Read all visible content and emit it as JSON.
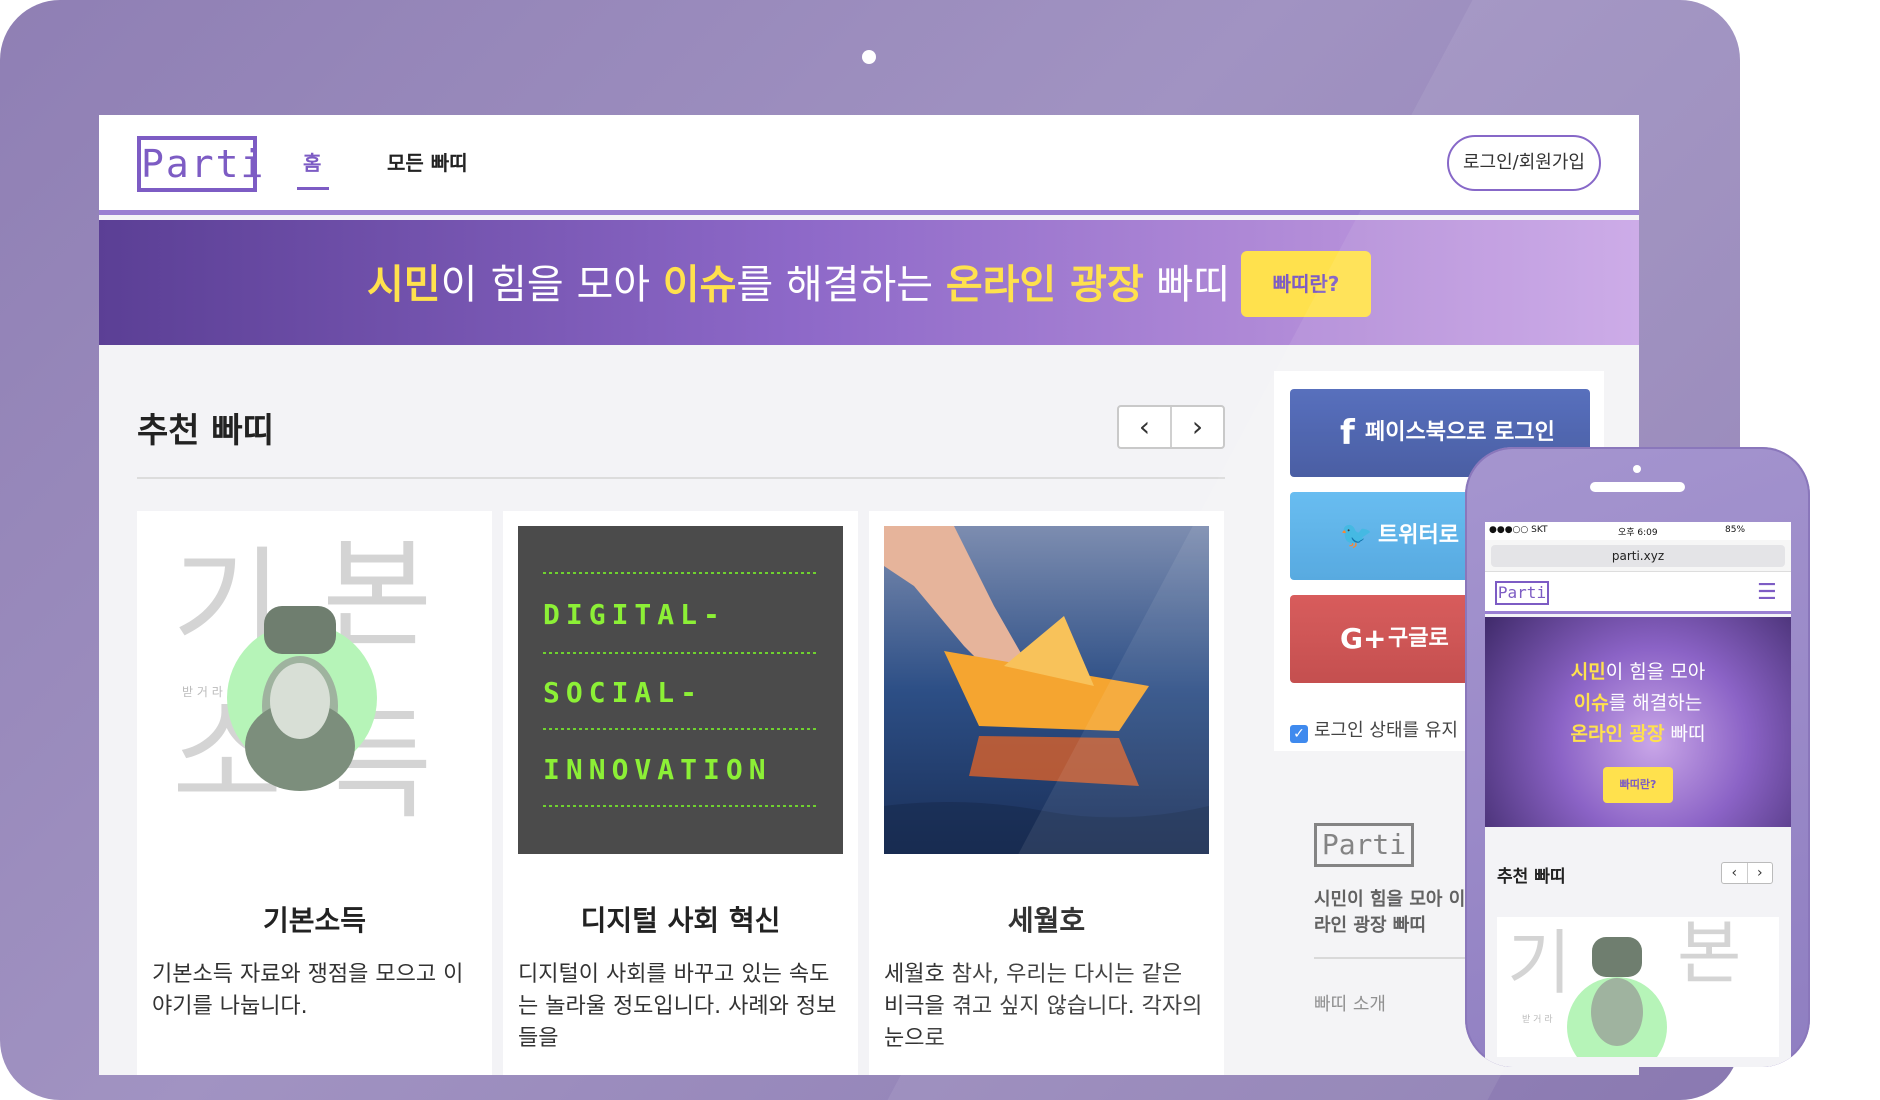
{
  "nav": {
    "logo": "Parti",
    "home": "홈",
    "all": "모든 빠띠",
    "login": "로그인/회원가입"
  },
  "hero": {
    "t1": "시민",
    "t2": "이 힘을 모아 ",
    "t3": "이슈",
    "t4": "를 해결하는 ",
    "t5": "온라인 광장",
    "t6": " 빠띠",
    "button": "빠띠란?"
  },
  "section": {
    "title": "추천 빠띠",
    "prev": "‹",
    "next": "›"
  },
  "cards": [
    {
      "title": "기본소득",
      "desc": "기본소득 자료와 쟁점을 모으고 이야기를 나눕니다.",
      "big_chars": [
        "기",
        "본",
        "소",
        "득"
      ],
      "small": "받 거 라"
    },
    {
      "title": "디지털 사회 혁신",
      "desc": "디지털이 사회를 바꾸고 있는 속도는 놀라울 정도입니다. 사례와 정보들을",
      "lines": [
        "DIGITAL-",
        "SOCIAL-",
        "INNOVATION"
      ]
    },
    {
      "title": "세월호",
      "desc": "세월호 참사, 우리는 다시는 같은 비극을 겪고 싶지 않습니다. 각자의 눈으로"
    }
  ],
  "side": {
    "facebook": "페이스북으로 로그인",
    "facebook_icon": "f",
    "twitter": "트위터로",
    "twitter_icon": "🐦",
    "google": "구글로",
    "google_icon": "G+",
    "keep": "로그인 상태를 유지"
  },
  "footer": {
    "logo": "Parti",
    "text": "시민이 힘을 모아 이슈 온라인 광장 빠띠",
    "intro": "빠띠 소개"
  },
  "phone": {
    "carrier": "●●●○○ SKT",
    "time": "오후 6:09",
    "battery": "85%",
    "url": "parti.xyz",
    "logo": "Parti",
    "hero_line1a": "시민",
    "hero_line1b": "이 힘을 모아",
    "hero_line2a": "이슈",
    "hero_line2b": "를 해결하는",
    "hero_line3a": "온라인 광장",
    "hero_line3b": " 빠띠",
    "button": "빠띠란?",
    "section": "추천 빠띠",
    "prev": "‹",
    "next": "›"
  },
  "colors": {
    "brand": "#7d5cc4",
    "accent": "#ffe14d",
    "facebook": "#3b519c",
    "twitter": "#4aa3de",
    "google": "#c04141"
  }
}
